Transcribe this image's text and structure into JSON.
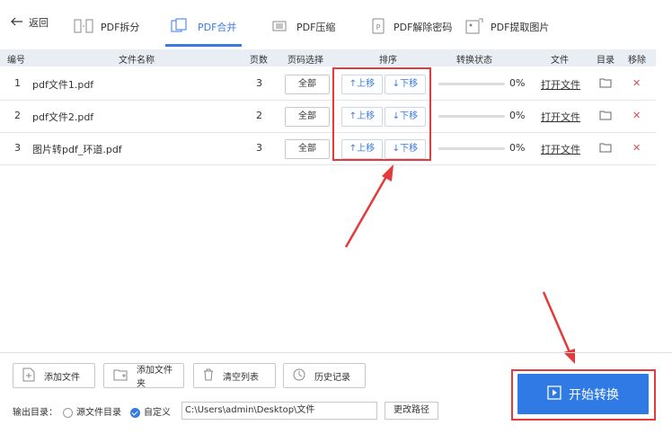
{
  "toolbar": {
    "back_label": "返回",
    "tabs": [
      {
        "label": "PDF拆分"
      },
      {
        "label": "PDF合并"
      },
      {
        "label": "PDF压缩"
      },
      {
        "label": "PDF解除密码"
      },
      {
        "label": "PDF提取图片"
      }
    ]
  },
  "table": {
    "columns": [
      "编号",
      "文件名称",
      "页数",
      "页码选择",
      "排序",
      "转换状态",
      "文件",
      "目录",
      "移除"
    ],
    "rows": [
      {
        "num": "1",
        "name": "pdf文件1.pdf",
        "pages": "3",
        "page_select": "全部",
        "up": "↑上移",
        "down": "↓下移",
        "progress": 0,
        "progress_label": "0%",
        "open": "打开文件"
      },
      {
        "num": "2",
        "name": "pdf文件2.pdf",
        "pages": "2",
        "page_select": "全部",
        "up": "↑上移",
        "down": "↓下移",
        "progress": 0,
        "progress_label": "0%",
        "open": "打开文件"
      },
      {
        "num": "3",
        "name": "图片转pdf_环道.pdf",
        "pages": "3",
        "page_select": "全部",
        "up": "↑上移",
        "down": "↓下移",
        "progress": 0,
        "progress_label": "0%",
        "open": "打开文件"
      }
    ]
  },
  "bottom": {
    "add_file": "添加文件",
    "add_folder": "添加文件夹",
    "clear_list": "清空列表",
    "history": "历史记录",
    "output_label": "输出目录：",
    "option_source": "源文件目录",
    "option_custom": "自定义",
    "path": "C:\\Users\\admin\\Desktop\\文件",
    "change_path": "更改路径",
    "start": "开始转换"
  },
  "colors": {
    "accent": "#2f7ae5",
    "annotation": "#e5393a",
    "delete": "#e24c4c",
    "header_bg": "#e9eef5"
  }
}
